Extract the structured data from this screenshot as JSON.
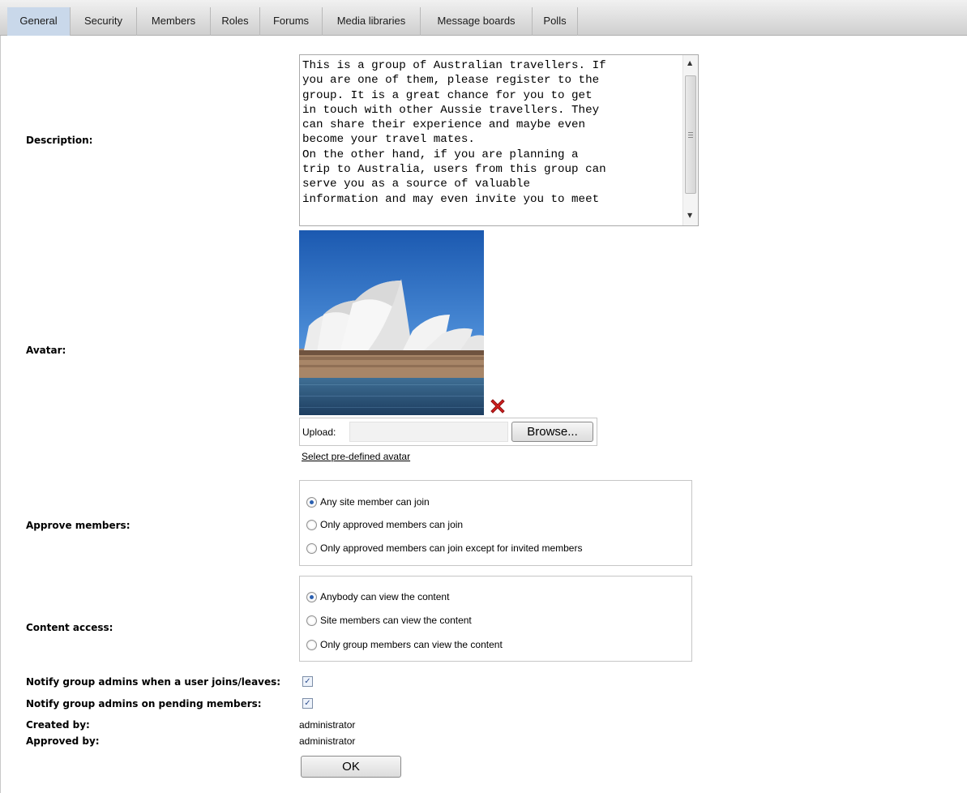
{
  "tabs": [
    {
      "label": "General",
      "active": true
    },
    {
      "label": "Security"
    },
    {
      "label": "Members"
    },
    {
      "label": "Roles"
    },
    {
      "label": "Forums"
    },
    {
      "label": "Media libraries"
    },
    {
      "label": "Message boards"
    },
    {
      "label": "Polls"
    }
  ],
  "description": {
    "label": "Description:",
    "value": "This is a group of Australian travellers. If\nyou are one of them, please register to the\ngroup. It is a great chance for you to get\nin touch with other Aussie travellers. They\ncan share their experience and maybe even\nbecome your travel mates.\nOn the other hand, if you are planning a\ntrip to Australia, users from this group can\nserve you as a source of valuable\ninformation and may even invite you to meet"
  },
  "avatar": {
    "label": "Avatar:",
    "image": "sydney-opera-house",
    "upload_label": "Upload:",
    "browse_label": "Browse...",
    "predefined_link": "Select pre-defined avatar"
  },
  "approve_members": {
    "label": "Approve members:",
    "options": [
      "Any site member can join",
      "Only approved members can join",
      "Only approved members can join except for invited members"
    ],
    "selected_index": 0
  },
  "content_access": {
    "label": "Content access:",
    "options": [
      "Anybody can view the content",
      "Site members can view the content",
      "Only group members can view the content"
    ],
    "selected_index": 0
  },
  "notify_join_leave": {
    "label": "Notify group admins when a user joins/leaves:",
    "checked": true
  },
  "notify_pending": {
    "label": "Notify group admins on pending members:",
    "checked": true
  },
  "created_by": {
    "label": "Created by:",
    "value": "administrator"
  },
  "approved_by": {
    "label": "Approved by:",
    "value": "administrator"
  },
  "ok_label": "OK",
  "colors": {
    "active_tab": "#c9d8ea",
    "delete_icon": "#d42020",
    "radio_dot": "#2a5fb0"
  }
}
